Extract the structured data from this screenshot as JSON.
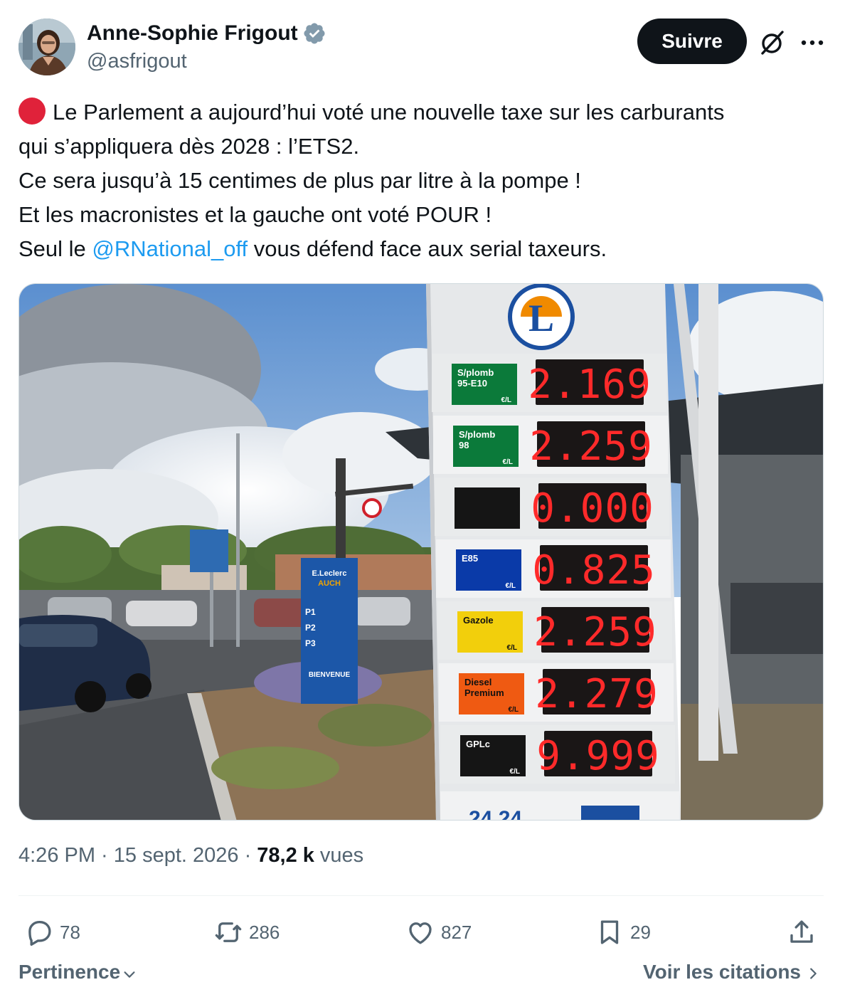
{
  "author": {
    "display_name": "Anne-Sophie Frigout",
    "handle": "@asfrigout",
    "verified": true
  },
  "header": {
    "follow_label": "Suivre",
    "grok_icon": "grok-icon",
    "more_icon": "more-icon"
  },
  "tweet": {
    "line1": "Le Parlement a aujourd’hui voté une nouvelle taxe sur les carburants",
    "line2": "qui s’appliquera dès 2028 : l’ETS2.",
    "line3": "Ce sera jusqu’à 15 centimes de plus par litre à la pompe !",
    "line4": "Et les macronistes et la gauche ont voté POUR !",
    "line5_prefix": "Seul le ",
    "mention": "@RNational_off",
    "line5_suffix": " vous défend face aux serial taxeurs."
  },
  "media": {
    "price_board": [
      {
        "label1": "S/plomb",
        "label2": "95-E10",
        "unit": "€/L",
        "price": "2.169",
        "color": "#0b7a3a",
        "text_color": "#ffffff"
      },
      {
        "label1": "S/plomb",
        "label2": "98",
        "unit": "€/L",
        "price": "2.259",
        "color": "#0b7a3a",
        "text_color": "#ffffff"
      },
      {
        "label1": "",
        "label2": "",
        "unit": "",
        "price": "0.000",
        "color": "#151515",
        "text_color": "#ffffff"
      },
      {
        "label1": "E85",
        "label2": "",
        "unit": "€/L",
        "price": "0.825",
        "color": "#0a3aa8",
        "text_color": "#ffffff"
      },
      {
        "label1": "Gazole",
        "label2": "",
        "unit": "€/L",
        "price": "2.259",
        "color": "#f2cf0c",
        "text_color": "#111111"
      },
      {
        "label1": "Diesel",
        "label2": "Premium",
        "unit": "€/L",
        "price": "2.279",
        "color": "#ef5a12",
        "text_color": "#111111"
      },
      {
        "label1": "GPLc",
        "label2": "",
        "unit": "€/L",
        "price": "9.999",
        "color": "#151515",
        "text_color": "#ffffff"
      }
    ],
    "brand_letter": "L",
    "store_sign": {
      "line1": "E.Leclerc",
      "line2": "AUCH",
      "p1": "P1",
      "p2": "P2",
      "p3": "P3",
      "welcome": "BIENVENUE"
    },
    "bottom_sign": "24 24"
  },
  "meta": {
    "time_date": "4:26 PM · 15 sept. 2026 ·",
    "views_count": "78,2 k",
    "views_label": "vues"
  },
  "actions": {
    "replies": "78",
    "reposts": "286",
    "likes": "827",
    "bookmarks": "29"
  },
  "footer": {
    "sort_label": "Pertinence",
    "quotes_label": "Voir les citations"
  },
  "colors": {
    "accent": "#1d9bf0",
    "text": "#0f1419",
    "secondary": "#536471",
    "led": "#ff2a2a"
  }
}
